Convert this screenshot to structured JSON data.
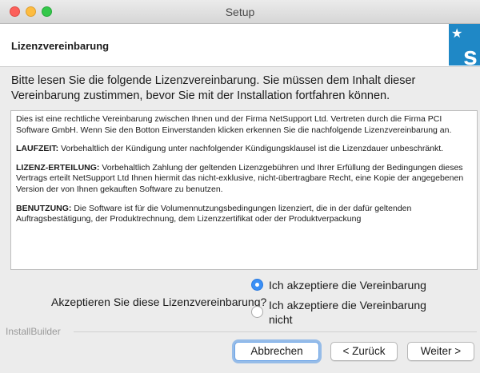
{
  "window": {
    "title": "Setup"
  },
  "header": {
    "title": "Lizenzvereinbarung"
  },
  "intro": "Bitte lesen Sie die folgende Lizenzvereinbarung. Sie müssen dem Inhalt dieser Vereinbarung zustimmen, bevor Sie mit der Installation fortfahren können.",
  "license": {
    "p1": "Dies ist eine rechtliche Vereinbarung zwischen Ihnen und der Firma NetSupport Ltd. Vertreten durch die Firma PCI Software GmbH. Wenn Sie den Botton Einverstanden klicken erkennen Sie die nachfolgende Lizenzvereinbarung an.",
    "p2_head": "LAUFZEIT:",
    "p2_body": " Vorbehaltlich der Kündigung unter nachfolgender Kündigungsklausel ist die Lizenzdauer unbeschränkt.",
    "p3_head": "LIZENZ-ERTEILUNG:",
    "p3_body": " Vorbehaltlich Zahlung der geltenden Lizenzgebühren und Ihrer Erfüllung der Bedingungen dieses Vertrags erteilt NetSupport Ltd Ihnen hiermit das nicht-exklusive, nicht-übertragbare Recht, eine Kopie der angegebenen Version der von Ihnen gekauften Software zu benutzen.",
    "p4_head": "BENUTZUNG:",
    "p4_body": " Die Software ist für die Volumennutzungsbedingungen lizenziert, die in der dafür geltenden Auftragsbestätigung, der Produktrechnung, dem Lizenzzertifikat oder der Produktverpackung"
  },
  "agreement": {
    "question": "Akzeptieren Sie diese Lizenzvereinbarung?",
    "accept_label": "Ich akzeptiere die Vereinbarung",
    "decline_label": "Ich akzeptiere die Vereinbarung nicht",
    "selected": "accept"
  },
  "footer": {
    "brand": "InstallBuilder",
    "cancel_label": "Abbrechen",
    "back_label": "< Zurück",
    "next_label": "Weiter >"
  },
  "colors": {
    "accent": "#3a8ff5",
    "logo": "#1f88c6"
  },
  "icons": {
    "logo": "installer-logo-icon",
    "radio_selected": "radio-selected-icon",
    "radio_unselected": "radio-unselected-icon"
  }
}
